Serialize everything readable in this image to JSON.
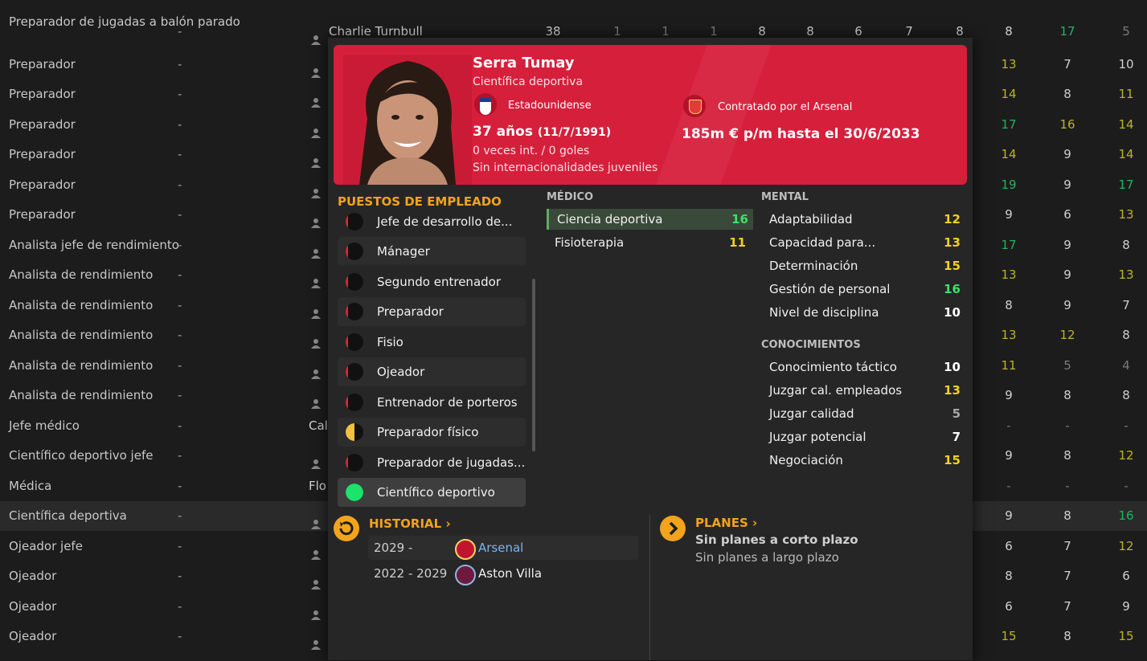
{
  "background_rows": [
    {
      "role": "Preparador de jugadas a balón parado",
      "dash": "-",
      "name": "Charlie Turnbull",
      "nums": [
        "38",
        "1",
        "1",
        "1",
        "8",
        "8",
        "6",
        "7",
        "8",
        "8",
        "17",
        "5"
      ],
      "colors": [
        "w",
        "g",
        "g",
        "g",
        "w",
        "w",
        "w",
        "w",
        "w",
        "w",
        "gr",
        "g"
      ],
      "highlight": false
    },
    {
      "role": "Preparador",
      "dash": "-",
      "nums": [
        "13",
        "7",
        "10"
      ],
      "colors": [
        "y",
        "w",
        "w"
      ],
      "highlight": false
    },
    {
      "role": "Preparador",
      "dash": "-",
      "nums": [
        "14",
        "8",
        "11"
      ],
      "colors": [
        "y",
        "w",
        "y"
      ],
      "highlight": false
    },
    {
      "role": "Preparador",
      "dash": "-",
      "nums": [
        "17",
        "16",
        "14"
      ],
      "colors": [
        "gr",
        "y",
        "y"
      ],
      "highlight": false
    },
    {
      "role": "Preparador",
      "dash": "-",
      "nums": [
        "14",
        "9",
        "14"
      ],
      "colors": [
        "y",
        "w",
        "y"
      ],
      "highlight": false
    },
    {
      "role": "Preparador",
      "dash": "-",
      "nums": [
        "19",
        "9",
        "17"
      ],
      "colors": [
        "gr",
        "w",
        "gr"
      ],
      "highlight": false
    },
    {
      "role": "Preparador",
      "dash": "-",
      "nums": [
        "9",
        "6",
        "13"
      ],
      "colors": [
        "w",
        "w",
        "y"
      ],
      "highlight": false
    },
    {
      "role": "Analista jefe de rendimiento",
      "dash": "-",
      "nums": [
        "17",
        "9",
        "8"
      ],
      "colors": [
        "gr",
        "w",
        "w"
      ],
      "highlight": false
    },
    {
      "role": "Analista de rendimiento",
      "dash": "-",
      "nums": [
        "13",
        "9",
        "13"
      ],
      "colors": [
        "y",
        "w",
        "y"
      ],
      "highlight": false
    },
    {
      "role": "Analista de rendimiento",
      "dash": "-",
      "nums": [
        "8",
        "9",
        "7"
      ],
      "colors": [
        "w",
        "w",
        "w"
      ],
      "highlight": false
    },
    {
      "role": "Analista de rendimiento",
      "dash": "-",
      "nums": [
        "13",
        "12",
        "8"
      ],
      "colors": [
        "y",
        "y",
        "w"
      ],
      "highlight": false
    },
    {
      "role": "Analista de rendimiento",
      "dash": "-",
      "nums": [
        "11",
        "5",
        "4"
      ],
      "colors": [
        "y",
        "g",
        "g"
      ],
      "highlight": false
    },
    {
      "role": "Analista de rendimiento",
      "dash": "-",
      "nums": [
        "9",
        "8",
        "8"
      ],
      "colors": [
        "w",
        "w",
        "w"
      ],
      "highlight": false
    },
    {
      "role": "Jefe médico",
      "dash": "-",
      "name": "Cal",
      "nums": [
        "-",
        "-",
        "-"
      ],
      "colors": [
        "g",
        "g",
        "g"
      ],
      "highlight": false
    },
    {
      "role": "Científico deportivo jefe",
      "dash": "-",
      "nums": [
        "9",
        "8",
        "12"
      ],
      "colors": [
        "w",
        "w",
        "y"
      ],
      "highlight": false
    },
    {
      "role": "Médica",
      "dash": "-",
      "name": "Flo",
      "nums": [
        "-",
        "-",
        "-"
      ],
      "colors": [
        "g",
        "g",
        "g"
      ],
      "highlight": false
    },
    {
      "role": "Científica deportiva",
      "dash": "-",
      "nums": [
        "9",
        "8",
        "16"
      ],
      "colors": [
        "w",
        "w",
        "gr"
      ],
      "highlight": true
    },
    {
      "role": "Ojeador jefe",
      "dash": "-",
      "nums": [
        "6",
        "7",
        "12"
      ],
      "colors": [
        "w",
        "w",
        "y"
      ],
      "highlight": false
    },
    {
      "role": "Ojeador",
      "dash": "-",
      "nums": [
        "8",
        "7",
        "6"
      ],
      "colors": [
        "w",
        "w",
        "w"
      ],
      "highlight": false
    },
    {
      "role": "Ojeador",
      "dash": "-",
      "nums": [
        "6",
        "7",
        "9"
      ],
      "colors": [
        "w",
        "w",
        "w"
      ],
      "highlight": false
    },
    {
      "role": "Ojeador",
      "dash": "-",
      "nums": [
        "15",
        "8",
        "15"
      ],
      "colors": [
        "y",
        "w",
        "y"
      ],
      "highlight": false
    }
  ],
  "profile": {
    "name": "Serra Tumay",
    "role": "Científica deportiva",
    "nationality": "Estadounidense",
    "nation_badge": "USA",
    "age": "37 años",
    "dob": "(11/7/1991)",
    "intl": "0 veces int. / 0 goles",
    "youth": "Sin internacionalidades juveniles",
    "contract_club": "Contratado por el Arsenal",
    "contract": "185m € p/m hasta el 30/6/2033",
    "header_color": "#d61f3b"
  },
  "roles": {
    "title": "PUESTOS DE EMPLEADO",
    "items": [
      {
        "label": "Jefe de desarrollo de...",
        "fill": 0.12,
        "color": "#e0223a"
      },
      {
        "label": "Mánager",
        "fill": 0.15,
        "color": "#e0223a"
      },
      {
        "label": "Segundo entrenador",
        "fill": 0.15,
        "color": "#e0223a"
      },
      {
        "label": "Preparador",
        "fill": 0.15,
        "color": "#e0223a"
      },
      {
        "label": "Fisio",
        "fill": 0.15,
        "color": "#e0223a"
      },
      {
        "label": "Ojeador",
        "fill": 0.15,
        "color": "#e0223a"
      },
      {
        "label": "Entrenador de porteros",
        "fill": 0.15,
        "color": "#e0223a"
      },
      {
        "label": "Preparador físico",
        "fill": 0.5,
        "color": "#f3c042"
      },
      {
        "label": "Preparador de jugadas...",
        "fill": 0.15,
        "color": "#e0223a"
      },
      {
        "label": "Científico deportivo",
        "fill": 1.0,
        "color": "#1be36b"
      }
    ]
  },
  "medico": {
    "title": "MÉDICO",
    "items": [
      {
        "label": "Ciencia deportiva",
        "value": "16",
        "color": "green"
      },
      {
        "label": "Fisioterapia",
        "value": "11",
        "color": "yellow"
      }
    ]
  },
  "mental": {
    "title": "MENTAL",
    "items": [
      {
        "label": "Adaptabilidad",
        "value": "12",
        "color": "yellow"
      },
      {
        "label": "Capacidad para...",
        "value": "13",
        "color": "yellow"
      },
      {
        "label": "Determinación",
        "value": "15",
        "color": "yellow"
      },
      {
        "label": "Gestión de personal",
        "value": "16",
        "color": "green"
      },
      {
        "label": "Nivel de disciplina",
        "value": "10",
        "color": "white"
      }
    ]
  },
  "knowledge": {
    "title": "CONOCIMIENTOS",
    "items": [
      {
        "label": "Conocimiento táctico",
        "value": "10",
        "color": "white"
      },
      {
        "label": "Juzgar cal. empleados",
        "value": "13",
        "color": "yellow"
      },
      {
        "label": "Juzgar calidad",
        "value": "5",
        "color": "grey"
      },
      {
        "label": "Juzgar potencial",
        "value": "7",
        "color": "white"
      },
      {
        "label": "Negociación",
        "value": "15",
        "color": "yellow"
      }
    ]
  },
  "history": {
    "title": "HISTORIAL",
    "rows": [
      {
        "years": "2029 -",
        "club": "Arsenal",
        "link": true
      },
      {
        "years": "2022 - 2029",
        "club": "Aston Villa",
        "link": false
      }
    ]
  },
  "plans": {
    "title": "PLANES",
    "short": "Sin planes a corto plazo",
    "long": "Sin planes a largo plazo"
  }
}
